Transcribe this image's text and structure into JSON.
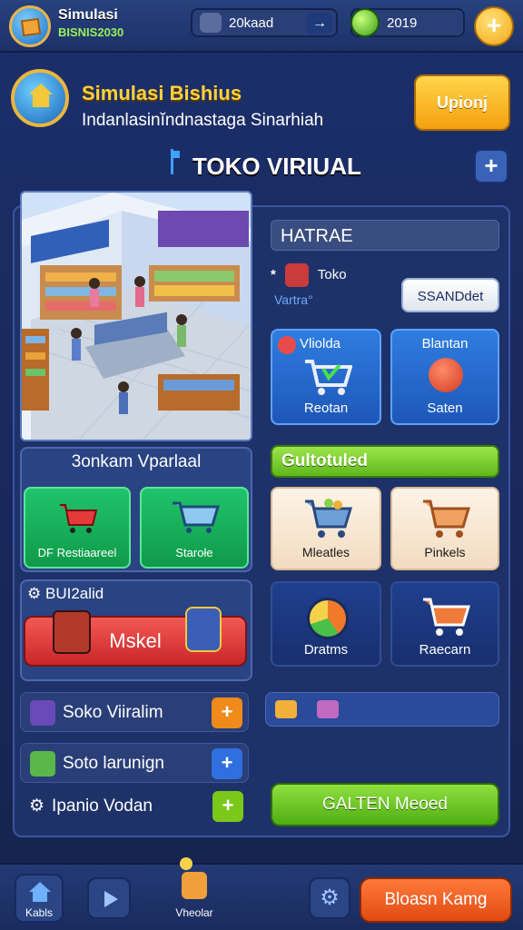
{
  "topbar": {
    "app_title": "Simulasi",
    "app_subtitle": "BISNIS2030",
    "player_name": "20kaad",
    "currency_value": "2019",
    "plus_label": "+"
  },
  "header": {
    "title": "Simulasi Bishius",
    "description": "Indanlasinĭndnastaga Sinarhiah",
    "upgrade_label": "Upionj"
  },
  "store": {
    "title": "TOKO VIRIUAL",
    "add_label": "+"
  },
  "right_panel": {
    "heading": "HATRAE",
    "toko_label": "Toko",
    "vartra_label": "Vartra°",
    "pill_label": "SSANDdet",
    "tiles_top": [
      {
        "title": "Vliolda",
        "label": "Reotan"
      },
      {
        "title": "Blantan",
        "label": "Saten"
      }
    ],
    "green_bar_label": "Gultotuled",
    "tiles_mid": [
      {
        "label": "Mleatles"
      },
      {
        "label": "Pinkels"
      }
    ],
    "tiles_bottom": [
      {
        "label": "Dratms"
      },
      {
        "label": "Raecarn"
      }
    ],
    "go_label": "GALTEN Meoed"
  },
  "left_panel": {
    "title": "3onkam Vparlaal",
    "tile_left": "DF Restiaareel",
    "tile_right": "Starołe",
    "section2_title": "BUI2alid",
    "red_button": "Mskel"
  },
  "list": [
    {
      "label": "Soko Viiralim",
      "btn": "+",
      "color": "#f08a1a"
    },
    {
      "label": "Soto larunign",
      "btn": "+",
      "color": "#2f6fe0"
    },
    {
      "label": "Ipanio Vodan",
      "btn": "+",
      "color": "#7ac81a"
    }
  ],
  "bottom_nav": {
    "home_label": "Kabls",
    "center_label": "Vheolar",
    "main_button": "Bloasn Kamg"
  }
}
